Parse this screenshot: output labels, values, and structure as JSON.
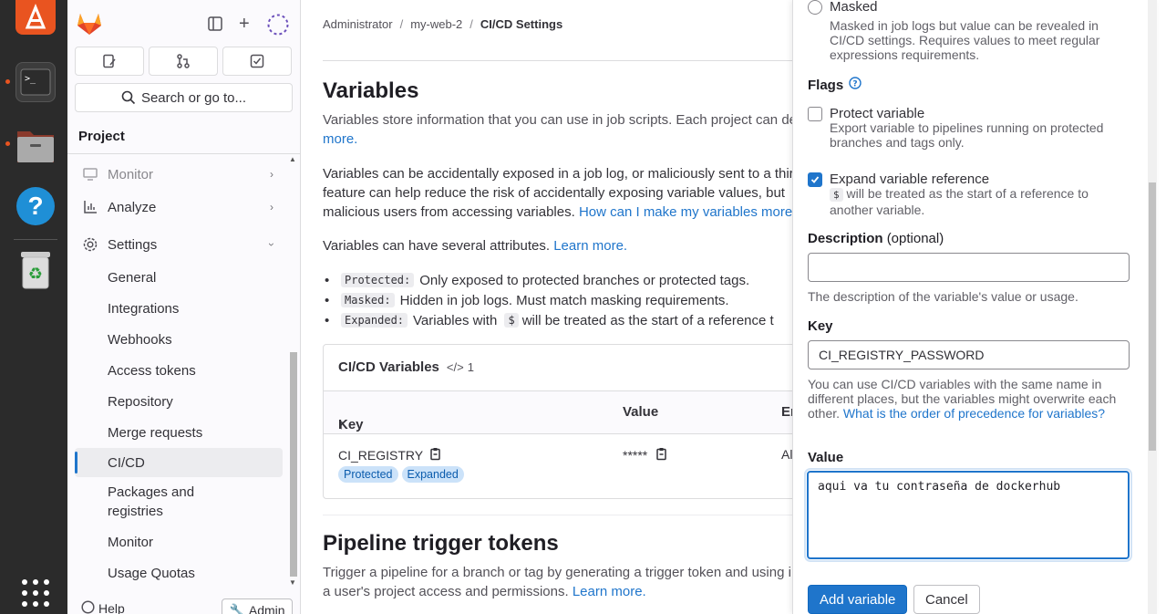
{
  "breadcrumb": {
    "items": [
      "Administrator",
      "my-web-2",
      "CI/CD Settings"
    ]
  },
  "sidebar": {
    "search_label": "Search or go to...",
    "project_label": "Project",
    "items": [
      {
        "label": "Monitor",
        "icon": "monitor-icon"
      },
      {
        "label": "Analyze",
        "icon": "chart-icon"
      },
      {
        "label": "Settings",
        "icon": "gear-icon"
      }
    ],
    "settings_sub": [
      "General",
      "Integrations",
      "Webhooks",
      "Access tokens",
      "Repository",
      "Merge requests",
      "CI/CD",
      "Packages and registries",
      "Monitor",
      "Usage Quotas"
    ],
    "help_label": "Help",
    "admin_label": "Admin"
  },
  "main": {
    "title": "Variables",
    "desc_line1": "Variables store information that you can use in job scripts. Each project can de",
    "desc_more": "more.",
    "warn_line1": "Variables can be accidentally exposed in a job log, or maliciously sent to a thir",
    "warn_line2": "feature can help reduce the risk of accidentally exposing variable values, but",
    "warn_line3_prefix": "malicious users from accessing variables.",
    "warn_link": "How can I make my variables more",
    "attrs_intro": "Variables can have several attributes.",
    "attrs_link": "Learn more.",
    "attrs": [
      {
        "tag": "Protected:",
        "text": "Only exposed to protected branches or protected tags."
      },
      {
        "tag": "Masked:",
        "text": "Hidden in job logs. Must match masking requirements."
      },
      {
        "tag": "Expanded:",
        "text": "Variables with",
        "code": "$",
        "text2": "will be treated as the start of a reference t"
      }
    ],
    "table": {
      "title": "CI/CD Variables",
      "count": "1",
      "col_key": "Key",
      "col_value": "Value",
      "col_env": "Er",
      "row": {
        "key": "CI_REGISTRY",
        "value": "*****",
        "env": "Al",
        "badges": [
          "Protected",
          "Expanded"
        ]
      }
    },
    "pipeline_title": "Pipeline trigger tokens",
    "pipeline_line1": "Trigger a pipeline for a branch or tag by generating a trigger token and using i",
    "pipeline_line2_prefix": "a user's project access and permissions.",
    "pipeline_link": "Learn more."
  },
  "drawer": {
    "masked_label": "Masked",
    "masked_help": "Masked in job logs but value can be revealed in CI/CD settings. Requires values to meet regular expressions requirements.",
    "flags_label": "Flags",
    "protect_label": "Protect variable",
    "protect_help": "Export variable to pipelines running on protected branches and tags only.",
    "expand_label": "Expand variable reference",
    "expand_code": "$",
    "expand_help": "will be treated as the start of a reference to another variable.",
    "desc_label": "Description",
    "desc_optional": "(optional)",
    "desc_value": "",
    "desc_help": "The description of the variable's value or usage.",
    "key_label": "Key",
    "key_value": "CI_REGISTRY_PASSWORD",
    "key_help": "You can use CI/CD variables with the same name in different places, but the variables might overwrite each other.",
    "key_link": "What is the order of precedence for variables?",
    "value_label": "Value",
    "value_value": "aqui va tu contraseña de dockerhub",
    "add_button": "Add variable",
    "cancel_button": "Cancel"
  },
  "colors": {
    "accent": "#1f75cb",
    "ubuntu": "#e95420",
    "sidebar_bg": "#fbfafd"
  }
}
